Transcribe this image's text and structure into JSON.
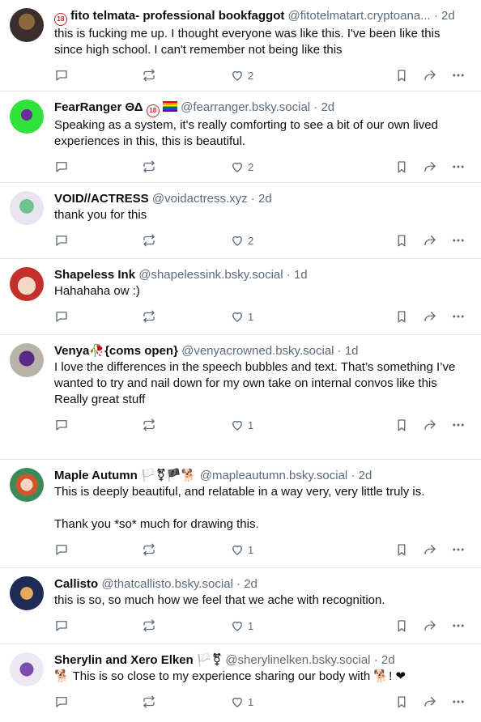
{
  "posts": [
    {
      "name": "fito telmata- professional bookfaggot",
      "handle": "@fitotelmatart.cryptoana...",
      "time": "2d",
      "text": "this is fucking me up. I thought everyone was like this. I've been like this since high school. I can't remember not being like this",
      "replies": "",
      "reposts": "",
      "likes": "2",
      "prefix_badge": "18",
      "avatar_colors": [
        "#3a2f2a",
        "#8a6a3c"
      ]
    },
    {
      "name": "FearRanger ΘΔ",
      "handle": "@fearranger.bsky.social",
      "time": "2d",
      "text": "Speaking as a system, it's really comforting to see a bit of our own lived experiences in this, this is beautiful.",
      "replies": "",
      "reposts": "",
      "likes": "2",
      "suffix_badge": "18",
      "avatar_colors": [
        "#31e23a",
        "#6a2e9a"
      ]
    },
    {
      "name": "VOID//ACTRESS",
      "handle": "@voidactress.xyz",
      "time": "2d",
      "text": "thank you for this",
      "replies": "",
      "reposts": "",
      "likes": "2",
      "avatar_colors": [
        "#e9e4f0",
        "#6fc38e"
      ]
    },
    {
      "name": "Shapeless Ink",
      "handle": "@shapelessink.bsky.social",
      "time": "1d",
      "text": "Hahahaha ow :)",
      "replies": "",
      "reposts": "",
      "likes": "1",
      "avatar_colors": [
        "#f4d8c4",
        "#c3322a"
      ]
    },
    {
      "name": "Venya",
      "name_suffix": "{coms open}",
      "handle": "@venyacrowned.bsky.social",
      "time": "1d",
      "text": "I love the differences in the speech bubbles and text. That’s something I’ve wanted to try and nail down for my own take on internal convos like this\nReally great stuff",
      "replies": "",
      "reposts": "",
      "likes": "1",
      "avatar_colors": [
        "#b9b2a8",
        "#5b2a86"
      ]
    },
    {
      "name": "Maple Autumn",
      "handle": "@mapleautumn.bsky.social",
      "time": "2d",
      "text": "This is deeply beautiful, and relatable in a way very, very little truly is.\n\nThank you *so* much for drawing this.",
      "replies": "",
      "reposts": "",
      "likes": "1",
      "avatar_colors": [
        "#3c8a5a",
        "#d4542a"
      ]
    },
    {
      "name": "Callisto",
      "handle": "@thatcallisto.bsky.social",
      "time": "2d",
      "text": "this is so, so much how we feel that we ache with recognition.",
      "replies": "",
      "reposts": "",
      "likes": "1",
      "avatar_colors": [
        "#1d2b55",
        "#e8a85a"
      ]
    },
    {
      "name": "Sherylin and Xero Elken",
      "handle": "@sherylinelken.bsky.social",
      "time": "2d",
      "text": "🐕 This is so close to my experience sharing our body with 🐕! ❤",
      "replies": "",
      "reposts": "",
      "likes": "1",
      "avatar_colors": [
        "#ede8f4",
        "#7a4eb0"
      ]
    }
  ],
  "icons": {
    "reply": "reply-icon",
    "repost": "repost-icon",
    "like": "heart-icon",
    "save": "bookmark-icon",
    "share": "share-icon",
    "more": "more-icon"
  },
  "name_emoji": {
    "fearranger": "🏳️‍🌈",
    "venya": "🥀",
    "maple": "🏳️⚧🏴🐕",
    "sherylin": "🏳️⚧"
  }
}
